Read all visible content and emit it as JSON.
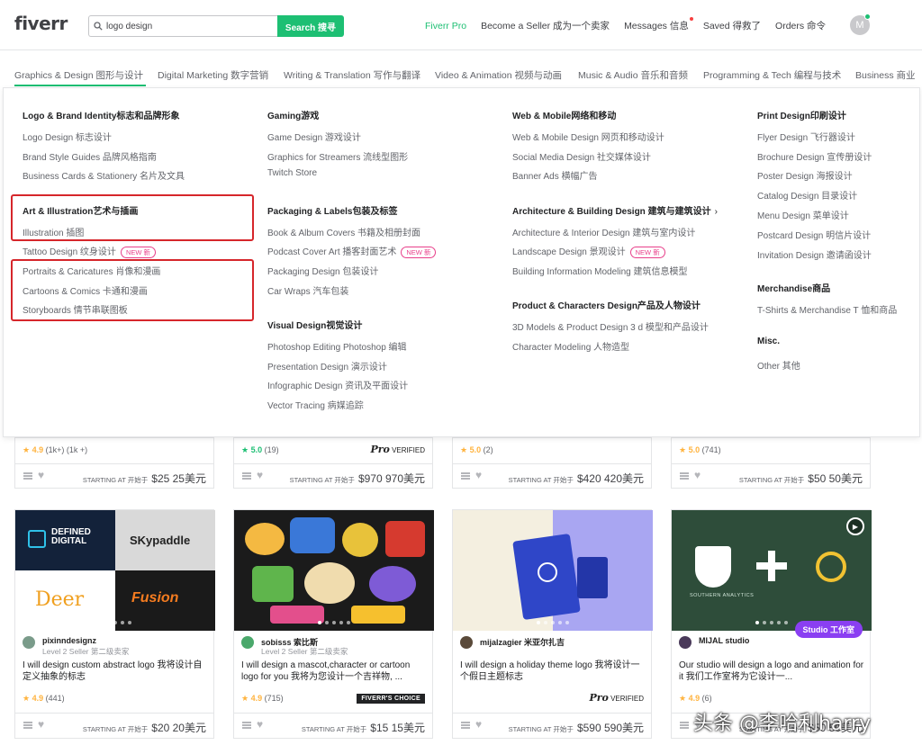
{
  "header": {
    "logo": "fiverr",
    "search_value": "logo design",
    "search_button": "Search 搜寻",
    "nav": [
      "Fiverr Pro",
      "Become a Seller 成为一个卖家",
      "Messages 信息",
      "Saved 得救了",
      "Orders 命令"
    ],
    "avatar_letter": "M"
  },
  "categories": [
    "Graphics & Design 图形与设计",
    "Digital Marketing 数字营销",
    "Writing & Translation 写作与翻译",
    "Video & Animation 视频与动画",
    "Music & Audio 音乐和音频",
    "Programming & Tech 编程与技术",
    "Business 商业"
  ],
  "menu": {
    "col1": {
      "h1": "Logo & Brand Identity标志和品牌形象",
      "i1": [
        "Logo Design 标志设计",
        "Brand Style Guides 品牌风格指南",
        "Business Cards & Stationery 名片及文具"
      ],
      "h2": "Art & Illustration艺术与插画",
      "i2": [
        "Illustration 插图",
        "Tattoo Design 纹身设计",
        "Portraits & Caricatures 肖像和漫画",
        "Cartoons & Comics 卡通和漫画",
        "Storyboards 情节串联图板"
      ]
    },
    "col2": {
      "h1": "Gaming游戏",
      "i1": [
        "Game Design 游戏设计",
        "Graphics for Streamers 流线型图形",
        "Twitch Store"
      ],
      "h2": "Packaging & Labels包装及标签",
      "i2": [
        "Book & Album Covers 书籍及相册封面",
        "Podcast Cover Art 播客封面艺术",
        "Packaging Design 包装设计",
        "Car Wraps 汽车包装"
      ],
      "h3": "Visual Design视觉设计",
      "i3": [
        "Photoshop Editing Photoshop 编辑",
        "Presentation Design 演示设计",
        "Infographic Design 资讯及平面设计",
        "Vector Tracing 病媒追踪"
      ]
    },
    "col3": {
      "h1": "Web & Mobile网络和移动",
      "i1": [
        "Web & Mobile Design 网页和移动设计",
        "Social Media Design 社交媒体设计",
        "Banner Ads 横幅广告"
      ],
      "h2": "Architecture & Building Design 建筑与建筑设计",
      "i2": [
        "Architecture & Interior Design 建筑与室内设计",
        "Landscape Design 景观设计",
        "Building Information Modeling 建筑信息模型"
      ],
      "h3": "Product & Characters Design产品及人物设计",
      "i3": [
        "3D Models & Product Design 3 d 模型和产品设计",
        "Character Modeling 人物造型"
      ]
    },
    "col4": {
      "h1": "Print Design印刷设计",
      "i1": [
        "Flyer Design 飞行器设计",
        "Brochure Design 宣传册设计",
        "Poster Design 海报设计",
        "Catalog Design 目录设计",
        "Menu Design 菜单设计",
        "Postcard Design 明信片设计",
        "Invitation Design 邀请函设计"
      ],
      "h2": "Merchandise商品",
      "i2": [
        "T-Shirts & Merchandise T 恤和商品"
      ],
      "h3": "Misc.",
      "i3": [
        "Other 其他"
      ]
    },
    "new_badge": "NEW 新"
  },
  "top_cards": [
    {
      "rating": "4.9",
      "count": "(1k+) (1k +)",
      "starting": "STARTING AT 开始于",
      "price": "$25 25美元",
      "pro": ""
    },
    {
      "rating": "5.0",
      "count": "(19)",
      "starting": "STARTING AT 开始于",
      "price": "$970 970美元",
      "pro": "VERIFIED"
    },
    {
      "rating": "5.0",
      "count": "(2)",
      "starting": "STARTING AT 开始于",
      "price": "$420 420美元",
      "pro": ""
    },
    {
      "rating": "5.0",
      "count": "(741)",
      "starting": "STARTING AT 开始于",
      "price": "$50 50美元",
      "pro": ""
    }
  ],
  "gigs": [
    {
      "seller": "pixinndesignz",
      "level": "Level 2 Seller 第二级卖家",
      "title": "I will design custom abstract logo 我将设计自定义抽象的标志",
      "rating": "4.9",
      "count": "(441)",
      "starting": "STARTING AT 开始于",
      "price": "$20 20美元",
      "thumb": [
        "DEFINED DIGITAL",
        "SKypaddle",
        "Deer",
        "Fusion"
      ]
    },
    {
      "seller": "sobisss 索比斯",
      "level": "Level 2 Seller 第二级卖家",
      "title": "I will design a mascot,character or cartoon logo for you 我将为您设计一个吉祥物, ...",
      "rating": "4.9",
      "count": "(715)",
      "badge": "FIVERR'S CHOICE",
      "starting": "STARTING AT 开始于",
      "price": "$15 15美元"
    },
    {
      "seller": "mijalzagier 米亚尔扎吉",
      "level": "",
      "title": "I will design a holiday theme logo 我将设计一个假日主题标志",
      "rating": "",
      "count": "",
      "pro": "VERIFIED",
      "starting": "STARTING AT 开始于",
      "price": "$590 590美元"
    },
    {
      "seller": "MIJAL studio",
      "level": "",
      "title": "Our studio will design a logo and animation for it 我们工作室将为它设计一...",
      "rating": "4.9",
      "count": "(6)",
      "studio": "Studio 工作室",
      "starting": "STARTING AT 开始于",
      "price": "$50 50美元",
      "thumb_text": "SOUTHERN ANALYTICS"
    }
  ],
  "watermark": "头条 @李哈利harry",
  "colors": {
    "brand_green": "#1dbf73",
    "highlight_red": "#d6262b",
    "new_pink": "#e83f8a",
    "studio_purple": "#8a3ff2",
    "star": "#ffb33e"
  }
}
